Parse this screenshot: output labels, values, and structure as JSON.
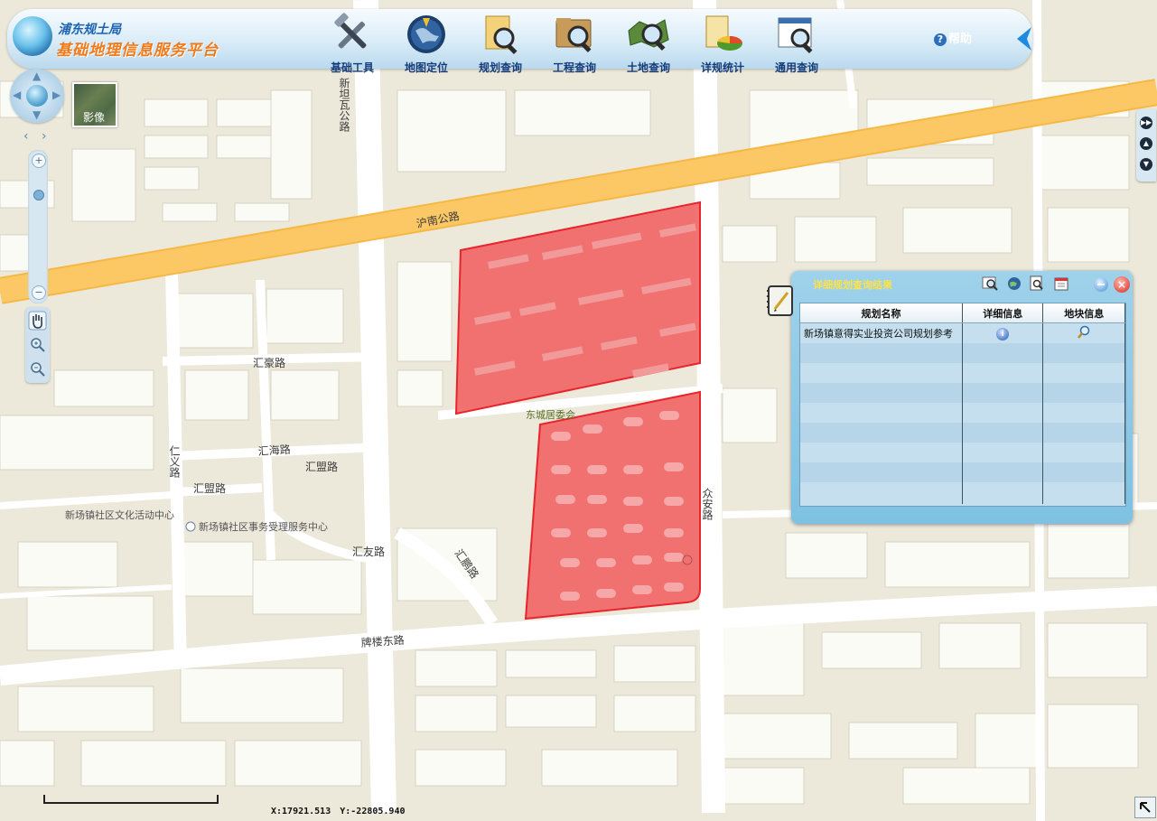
{
  "header": {
    "org_name": "浦东规土局",
    "app_title": "基础地理信息服务平台",
    "toolbar": [
      {
        "label": "基础工具",
        "icon": "tools-icon"
      },
      {
        "label": "地图定位",
        "icon": "globe-locate-icon"
      },
      {
        "label": "规划查询",
        "icon": "plan-search-icon"
      },
      {
        "label": "工程查询",
        "icon": "project-search-icon"
      },
      {
        "label": "土地查询",
        "icon": "land-search-icon"
      },
      {
        "label": "详规统计",
        "icon": "statistics-icon"
      },
      {
        "label": "通用查询",
        "icon": "general-search-icon"
      }
    ],
    "help_label": "帮助"
  },
  "layer_switch": {
    "label": "影像"
  },
  "map": {
    "roads": {
      "xintanwa": "新坦瓦公路",
      "hunan": "沪南公路",
      "huihao": "汇豪路",
      "huihai": "汇海路",
      "huimeng_1": "汇盟路",
      "huimeng_2": "汇盟路",
      "renyi": "仁义路",
      "huiyou": "汇友路",
      "huipeng": "汇鹏路",
      "zhongan": "众安路",
      "pailou_dong": "牌楼东路"
    },
    "pois": {
      "dongcheng": "东城居委会",
      "culture_center": "新场镇社区文化活动中心",
      "service_center": "新场镇社区事务受理服务中心"
    },
    "colors": {
      "background": "#ece8da",
      "highway": "#fbc865",
      "parcel_fill": "#f06060",
      "parcel_stroke": "#e8242c"
    }
  },
  "results_window": {
    "title": "详细规划查询结果",
    "columns": [
      "规划名称",
      "详细信息",
      "地块信息"
    ],
    "rows": [
      {
        "name": "新场镇意得实业投资公司规划参考",
        "detail_icon": "info-icon",
        "parcel_icon": "magnifier-icon"
      }
    ],
    "empty_rows": 8
  },
  "status": {
    "coord_x": "X:17921.513",
    "coord_y": "Y:-22805.940"
  }
}
